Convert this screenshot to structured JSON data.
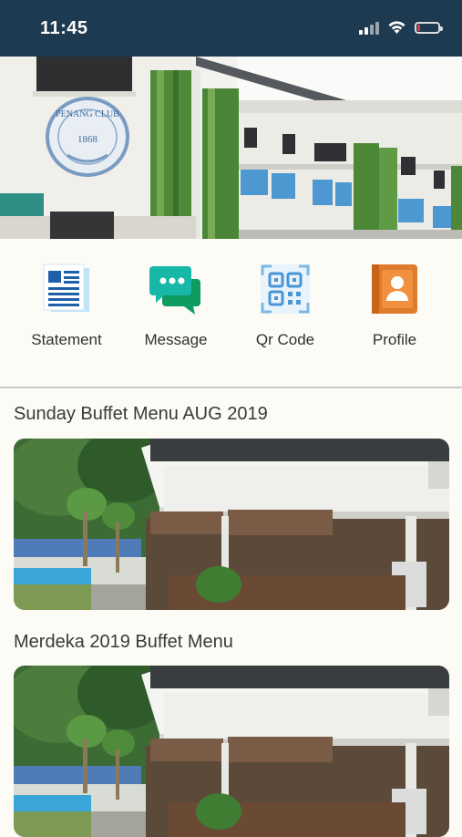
{
  "status_bar": {
    "time": "11:45",
    "icons": [
      "cellular-signal-icon",
      "wifi-icon",
      "battery-low-icon"
    ],
    "battery_color": "#e53935",
    "battery_level": 0.15
  },
  "hero": {
    "image": "penang-club-building",
    "logo_text": "PENANG CLUB",
    "logo_year": "1868"
  },
  "menu": [
    {
      "label": "Statement",
      "icon": "statement-icon"
    },
    {
      "label": "Message",
      "icon": "message-icon"
    },
    {
      "label": "Qr Code",
      "icon": "qr-code-icon"
    },
    {
      "label": "Profile",
      "icon": "profile-icon"
    }
  ],
  "feed": [
    {
      "title": "Sunday Buffet Menu AUG 2019",
      "image": "clubhouse-terrace-photo"
    },
    {
      "title": "Merdeka 2019 Buffet Menu",
      "image": "clubhouse-terrace-photo"
    }
  ],
  "colors": {
    "status_bar": "#1d3a50",
    "background": "#fcfbf6",
    "message_accent": "#18b8a8",
    "profile_accent": "#e07b2c",
    "statement_accent": "#1d5fa8"
  }
}
